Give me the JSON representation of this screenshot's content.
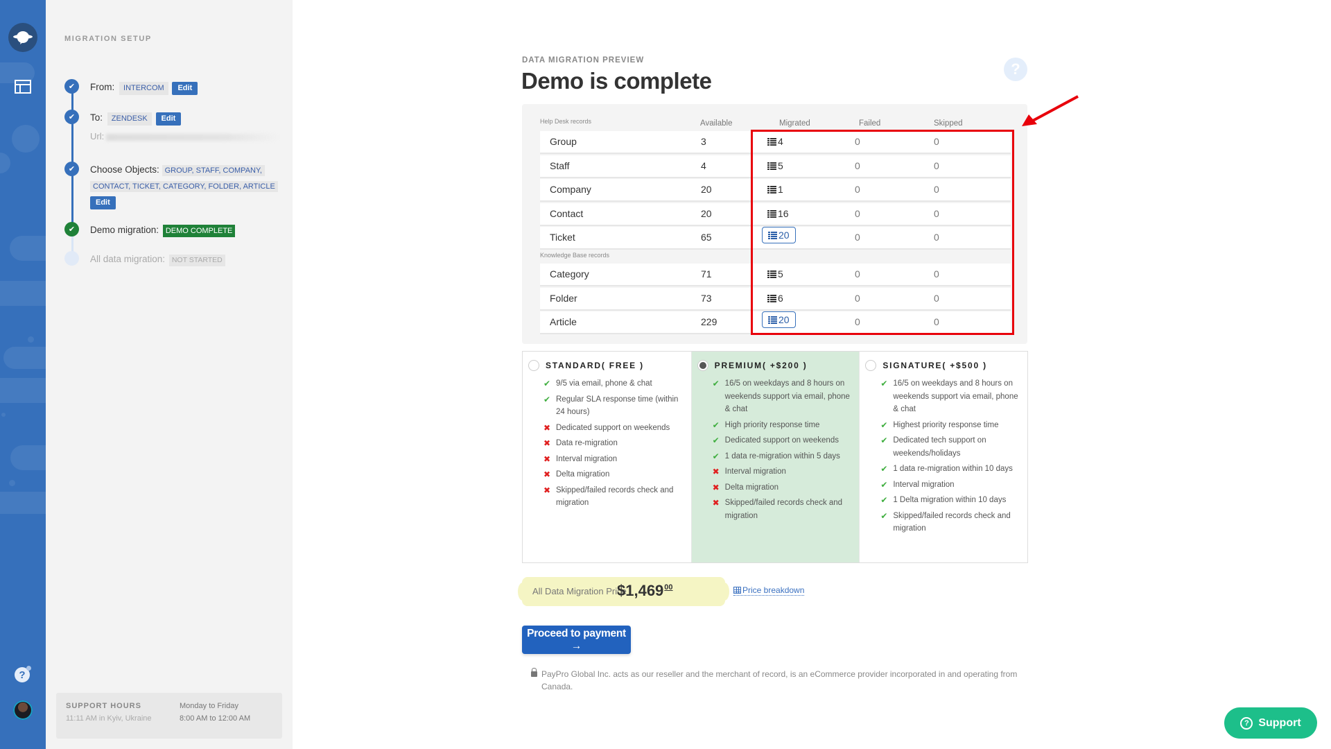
{
  "rail": {
    "logo_icon": "planet-chat-icon",
    "nav_icon": "layout-icon",
    "help_icon": "help-icon",
    "avatar": "user-avatar"
  },
  "setup": {
    "title": "MIGRATION SETUP",
    "steps": [
      {
        "label": "From:",
        "value": "INTERCOM",
        "action": "Edit",
        "state": "complete"
      },
      {
        "label": "To:",
        "value": "ZENDESK",
        "action": "Edit",
        "state": "complete",
        "url_label": "Url:"
      },
      {
        "label": "Choose Objects:",
        "value_line1": "GROUP, STAFF, COMPANY,",
        "value_line2": "CONTACT, TICKET, CATEGORY, FOLDER, ARTICLE",
        "action": "Edit",
        "state": "complete"
      },
      {
        "label": "Demo migration:",
        "status": "DEMO COMPLETE",
        "state": "done"
      },
      {
        "label": "All data migration:",
        "status": "NOT STARTED",
        "state": "pending"
      }
    ],
    "support_hours": {
      "title": "SUPPORT HOURS",
      "local_time": "11:11 AM in Kyiv, Ukraine",
      "days": "Monday to Friday",
      "hours": "8:00 AM to 12:00 AM"
    }
  },
  "main": {
    "eyebrow": "DATA MIGRATION PREVIEW",
    "title": "Demo is complete",
    "help_icon": "?",
    "table": {
      "headers": {
        "section1": "Help Desk records",
        "available": "Available",
        "migrated": "Migrated",
        "failed": "Failed",
        "skipped": "Skipped"
      },
      "section2": "Knowledge Base records",
      "helpdesk_rows": [
        {
          "name": "Group",
          "available": "3",
          "migrated": "4",
          "failed": "0",
          "skipped": "0",
          "button": false
        },
        {
          "name": "Staff",
          "available": "4",
          "migrated": "5",
          "failed": "0",
          "skipped": "0",
          "button": false
        },
        {
          "name": "Company",
          "available": "20",
          "migrated": "1",
          "failed": "0",
          "skipped": "0",
          "button": false
        },
        {
          "name": "Contact",
          "available": "20",
          "migrated": "16",
          "failed": "0",
          "skipped": "0",
          "button": false
        },
        {
          "name": "Ticket",
          "available": "65",
          "migrated": "20",
          "failed": "0",
          "skipped": "0",
          "button": true
        }
      ],
      "kb_rows": [
        {
          "name": "Category",
          "available": "71",
          "migrated": "5",
          "failed": "0",
          "skipped": "0",
          "button": false
        },
        {
          "name": "Folder",
          "available": "73",
          "migrated": "6",
          "failed": "0",
          "skipped": "0",
          "button": false
        },
        {
          "name": "Article",
          "available": "229",
          "migrated": "20",
          "failed": "0",
          "skipped": "0",
          "button": true
        }
      ]
    },
    "plans": [
      {
        "title": "STANDARD( FREE )",
        "selected": false,
        "features": [
          {
            "ok": true,
            "text": "9/5 via email, phone & chat"
          },
          {
            "ok": true,
            "text": "Regular SLA response time (within 24 hours)"
          },
          {
            "ok": false,
            "text": "Dedicated support on weekends"
          },
          {
            "ok": false,
            "text": "Data re-migration"
          },
          {
            "ok": false,
            "text": "Interval migration"
          },
          {
            "ok": false,
            "text": "Delta migration"
          },
          {
            "ok": false,
            "text": "Skipped/failed records check and migration"
          }
        ]
      },
      {
        "title": "PREMIUM( +$200 )",
        "selected": true,
        "features": [
          {
            "ok": true,
            "text": "16/5 on weekdays and 8 hours on weekends support via email, phone & chat"
          },
          {
            "ok": true,
            "text": "High priority response time"
          },
          {
            "ok": true,
            "text": "Dedicated support on weekends"
          },
          {
            "ok": true,
            "text": "1 data re-migration within 5 days"
          },
          {
            "ok": false,
            "text": "Interval migration"
          },
          {
            "ok": false,
            "text": "Delta migration"
          },
          {
            "ok": false,
            "text": "Skipped/failed records check and migration"
          }
        ]
      },
      {
        "title": "SIGNATURE( +$500 )",
        "selected": false,
        "features": [
          {
            "ok": true,
            "text": "16/5 on weekdays and 8 hours on weekends support via email, phone & chat"
          },
          {
            "ok": true,
            "text": "Highest priority response time"
          },
          {
            "ok": true,
            "text": "Dedicated tech support on weekends/holidays"
          },
          {
            "ok": true,
            "text": "1 data re-migration within 10 days"
          },
          {
            "ok": true,
            "text": "Interval migration"
          },
          {
            "ok": true,
            "text": "1 Delta migration within 10 days"
          },
          {
            "ok": true,
            "text": "Skipped/failed records check and migration"
          }
        ]
      }
    ],
    "price": {
      "label": "All Data Migration Price",
      "amount": "$1,469",
      "cents": "00",
      "breakdown_link": "Price breakdown"
    },
    "proceed_button": "Proceed to payment →",
    "paypro_note": "PayPro Global Inc. acts as our reseller and the merchant of record, is an eCommerce provider incorporated in and operating from Canada."
  },
  "support_button": {
    "label": "Support"
  },
  "colors": {
    "rail": "#3670bb",
    "accent": "#2262be",
    "done_green": "#1f8138",
    "selected_plan": "#d6ebda",
    "price_bg": "#f5f5c4",
    "support_btn": "#1dbf8a",
    "annotation_red": "#e8000b"
  }
}
